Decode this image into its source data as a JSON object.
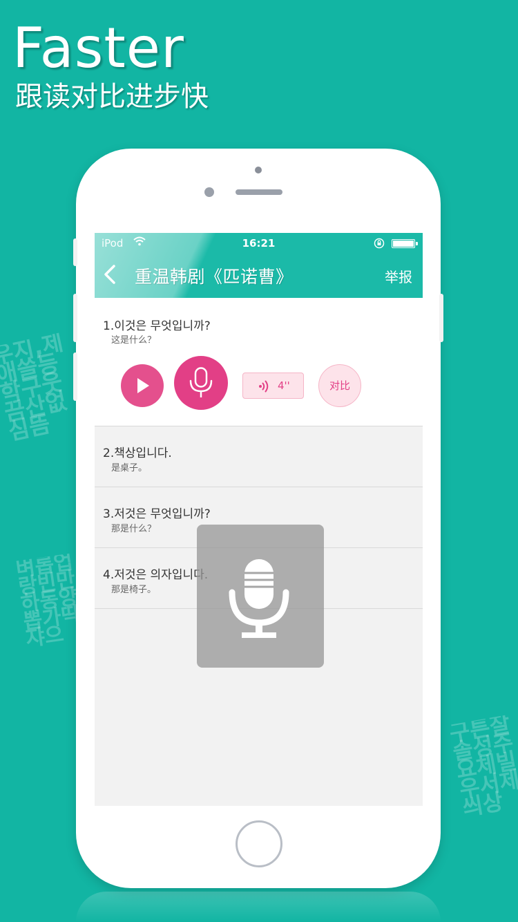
{
  "hero": {
    "title": "Faster",
    "subtitle": "跟读对比进步快"
  },
  "decor": {
    "left_cloud_1": "우지,제애쓸등학구웃끔산없심뜸",
    "left_cloud_2": "벼롭업랑빈만하동양뽑가딱쟈으",
    "right_cloud": "구튼잘솔성주요체빌우서제씌상"
  },
  "status_bar": {
    "carrier": "iPod",
    "time": "16:21"
  },
  "app_bar": {
    "title": "重温韩剧《匹诺曹》",
    "action": "举报"
  },
  "items": [
    {
      "korean": "1.이것은 무엇입니까?",
      "chinese": "这是什么？"
    },
    {
      "korean": "2.책상입니다.",
      "chinese": "是桌子。"
    },
    {
      "korean": "3.저것은 무엇입니까?",
      "chinese": "那是什么？"
    },
    {
      "korean": "4.저것은 의자입니다.",
      "chinese": "那是椅子。"
    }
  ],
  "controls": {
    "playback_duration": "4''",
    "compare_label": "对比"
  },
  "icons": {
    "play": "play-icon",
    "record": "microphone-icon",
    "playback": "sound-wave-icon",
    "back": "chevron-left-icon",
    "overlay": "microphone-icon"
  },
  "colors": {
    "background": "#12b5a3",
    "app_bar": "#1bbaa8",
    "accent_pink": "#e23f86",
    "pink_light": "#fde3ea"
  }
}
